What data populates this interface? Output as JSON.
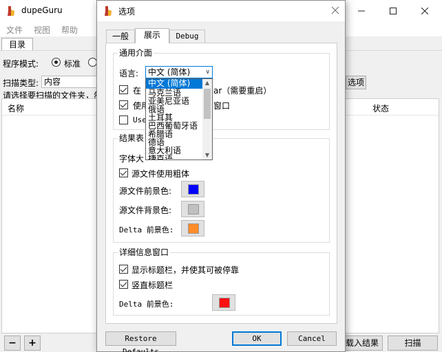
{
  "main_window": {
    "title": "dupeGuru",
    "menu": [
      "文件",
      "视图",
      "帮助"
    ],
    "tab_label": "目录",
    "app_mode_label": "程序模式:",
    "app_mode_standard": "标准",
    "scan_type_label": "扫描类型:",
    "scan_type_value": "内容",
    "instructions": "请选择要扫描的文件夹，然",
    "list_header_name": "名称",
    "list_header_state": "状态",
    "more_options_button": "选项",
    "add_button": "+",
    "remove_button": "−",
    "load_results_button": "载入结果",
    "scan_button": "扫描"
  },
  "dialog": {
    "title": "选项",
    "tabs": [
      "一般",
      "展示",
      "Debug"
    ],
    "active_tab": "展示",
    "general_interface": {
      "title": "通用介面",
      "language_label": "语言:",
      "language_value": "中文 (简体)",
      "languages": [
        "中文 (简体)",
        "马克兰语",
        "亚美尼亚语",
        "俄语",
        "土耳其",
        "巴西葡萄牙语",
        "希腊语",
        "德语",
        "意大利语",
        "捷克语"
      ],
      "cb1_visible": "在",
      "cb1_suffix": "ar（需要重启）",
      "cb2_visible": "使用",
      "cb2_suffix": "窗口",
      "cb3_visible": "Use"
    },
    "result_table": {
      "title": "结果表",
      "font_size_label": "字体大",
      "bold_ref_label": "源文件使用粗体",
      "ref_fg_label": "源文件前景色:",
      "ref_bg_label": "源文件背景色:",
      "delta_fg_label": "Delta 前景色:",
      "ref_fg_color": "#0000ff",
      "ref_bg_color": "#c0c0c0",
      "delta_fg_color": "#ff8c28"
    },
    "details_window": {
      "title": "详细信息窗口",
      "show_titlebar_label": "显示标题栏，并使其可被停靠",
      "vertical_titlebar_label": "竖直标题栏",
      "delta_fg_label": "Delta 前景色:",
      "delta_fg_color": "#ff1010"
    },
    "restore_defaults_button": "Restore Defaults",
    "ok_button": "OK",
    "cancel_button": "Cancel"
  }
}
